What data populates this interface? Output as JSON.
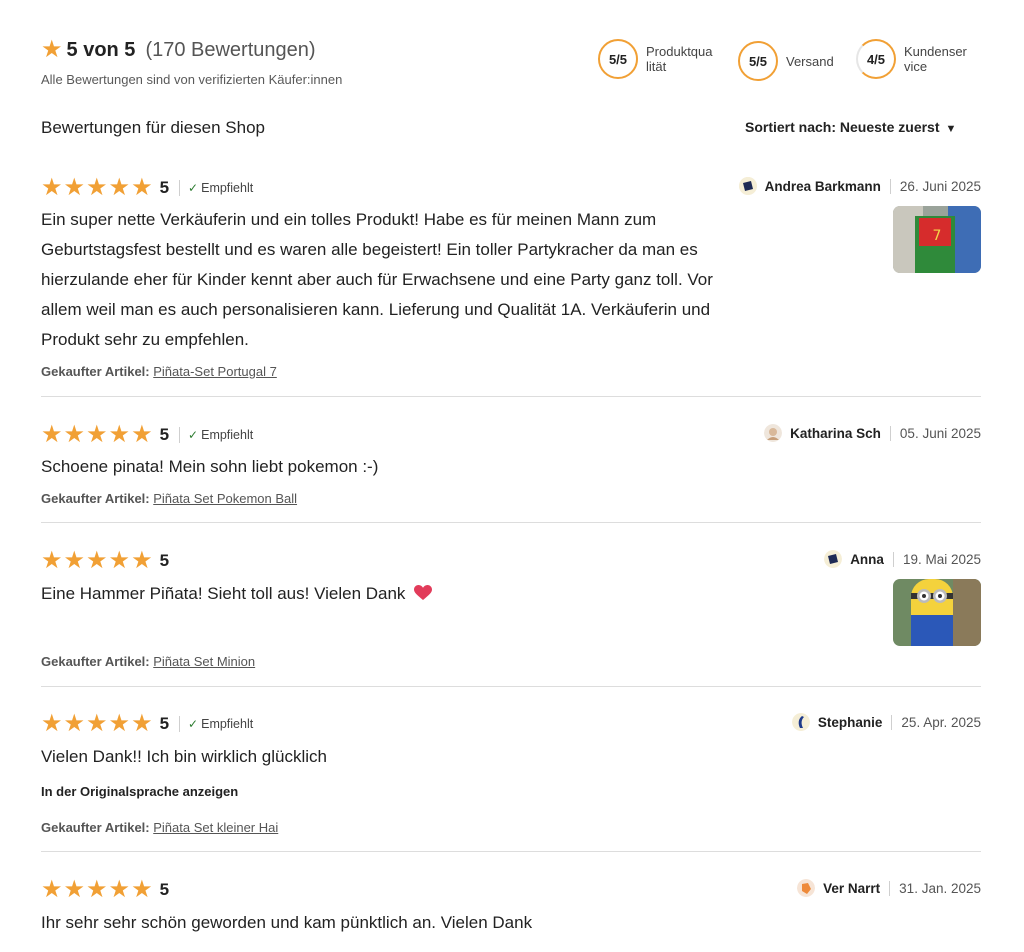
{
  "summary": {
    "star_icon": "star-icon",
    "score": "5 von 5",
    "count": "(170 Bewertungen)",
    "verified_note": "Alle Bewertungen sind von verifizierten Käufer:innen"
  },
  "badges": [
    {
      "value": "5/5",
      "label_l1": "Produktqua",
      "label_l2": "lität"
    },
    {
      "value": "5/5",
      "label_l1": "Versand",
      "label_l2": ""
    },
    {
      "value": "4/5",
      "label_l1": "Kundenser",
      "label_l2": "vice"
    }
  ],
  "section_title": "Bewertungen für diesen Shop",
  "sort": {
    "label": "Sortiert nach: Neueste zuerst",
    "caret": "▼"
  },
  "purchased_label": "Gekaufter Artikel:",
  "recommend_label": "Empfiehlt",
  "original_lang_label": "In der Originalsprache anzeigen",
  "reviews": [
    {
      "rating": "5",
      "recommends": true,
      "author": "Andrea Barkmann",
      "date": "26. Juni 2025",
      "text_lines": [
        "Ein super nette Verkäuferin und ein tolles Produkt! Habe es für meinen Mann zum",
        "Geburtstagsfest bestellt und es waren alle begeistert! Ein toller Partykracher da man es",
        "hierzulande eher für Kinder kennt aber auch für Erwachsene und eine Party ganz toll. Vor",
        "allem weil man es auch personalisieren kann. Lieferung und Qualität 1A. Verkäuferin und",
        "Produkt sehr zu empfehlen."
      ],
      "item": "Piñata-Set Portugal 7",
      "has_photo": true
    },
    {
      "rating": "5",
      "recommends": true,
      "author": "Katharina Sch",
      "date": "05. Juni 2025",
      "text": "Schoene pinata! Mein sohn liebt pokemon :-)",
      "item": "Piñata Set Pokemon Ball",
      "has_photo": false
    },
    {
      "rating": "5",
      "recommends": false,
      "author": "Anna",
      "date": "19. Mai 2025",
      "text": "Eine Hammer Piñata! Sieht toll aus! Vielen Dank",
      "heart_icon": "heart-icon",
      "item": "Piñata Set Minion",
      "has_photo": true
    },
    {
      "rating": "5",
      "recommends": true,
      "author": "Stephanie",
      "date": "25. Apr. 2025",
      "text": "Vielen Dank!! Ich bin wirklich glücklich",
      "show_original": true,
      "item": "Piñata Set kleiner Hai",
      "has_photo": false
    },
    {
      "rating": "5",
      "recommends": false,
      "author": "Ver Narrt",
      "date": "31. Jan. 2025",
      "text": "Ihr sehr sehr schön geworden und kam pünktlich an. Vielen Dank",
      "has_photo": false
    }
  ],
  "colors": {
    "accent": "#f1a035",
    "text": "#222222",
    "muted": "#555555",
    "divider": "#dddddd"
  }
}
